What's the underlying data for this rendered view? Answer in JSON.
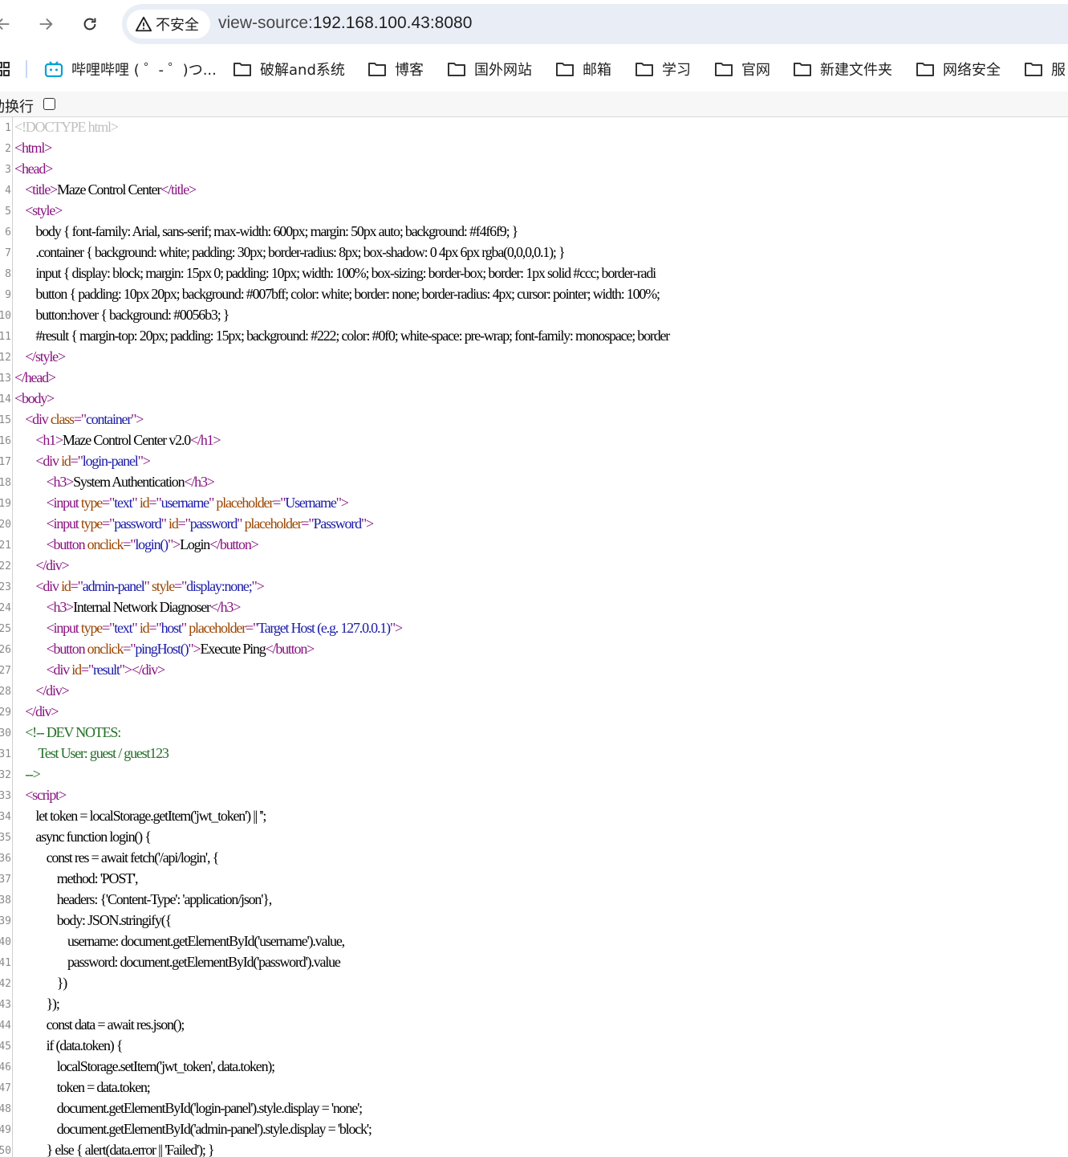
{
  "toolbar": {
    "security_label": "不安全",
    "url_scheme": "view-source:",
    "url_host": "192.168.100.43:8080"
  },
  "bookmarks": [
    {
      "label": "哔哩哔哩 ( ゜- ゜)つ...",
      "icon": "bilibili-icon"
    },
    {
      "label": "破解and系统",
      "icon": "folder-icon"
    },
    {
      "label": "博客",
      "icon": "folder-icon"
    },
    {
      "label": "国外网站",
      "icon": "folder-icon"
    },
    {
      "label": "邮箱",
      "icon": "folder-icon"
    },
    {
      "label": "学习",
      "icon": "folder-icon"
    },
    {
      "label": "官网",
      "icon": "folder-icon"
    },
    {
      "label": "新建文件夹",
      "icon": "folder-icon"
    },
    {
      "label": "网络安全",
      "icon": "folder-icon"
    },
    {
      "label": "服",
      "icon": "folder-icon"
    }
  ],
  "wrap_bar": {
    "label": "动换行",
    "checked": false
  },
  "colors": {
    "tag": "#881280",
    "attribute": "#994500",
    "value": "#1a1aa6",
    "comment": "#236e25",
    "doctype": "#c0c0c0"
  },
  "source_lines": [
    [
      [
        "dt",
        "<!DOCTYPE html>"
      ]
    ],
    [
      [
        "tag",
        "<html>"
      ]
    ],
    [
      [
        "tag",
        "<head>"
      ]
    ],
    [
      [
        "",
        "    "
      ],
      [
        "tag",
        "<title>"
      ],
      [
        "",
        "Maze Control Center"
      ],
      [
        "tag",
        "</title>"
      ]
    ],
    [
      [
        "",
        "    "
      ],
      [
        "tag",
        "<style>"
      ]
    ],
    [
      [
        "",
        "        body { font-family: Arial, sans-serif; max-width: 600px; margin: 50px auto; background: #f4f6f9; }"
      ]
    ],
    [
      [
        "",
        "        .container { background: white; padding: 30px; border-radius: 8px; box-shadow: 0 4px 6px rgba(0,0,0,0.1); }"
      ]
    ],
    [
      [
        "",
        "        input { display: block; margin: 15px 0; padding: 10px; width: 100%; box-sizing: border-box; border: 1px solid #ccc; border-radi"
      ]
    ],
    [
      [
        "",
        "        button { padding: 10px 20px; background: #007bff; color: white; border: none; border-radius: 4px; cursor: pointer; width: 100%;"
      ]
    ],
    [
      [
        "",
        "        button:hover { background: #0056b3; }"
      ]
    ],
    [
      [
        "",
        "        #result { margin-top: 20px; padding: 15px; background: #222; color: #0f0; white-space: pre-wrap; font-family: monospace; border"
      ]
    ],
    [
      [
        "",
        "    "
      ],
      [
        "tag",
        "</style>"
      ]
    ],
    [
      [
        "tag",
        "</head>"
      ]
    ],
    [
      [
        "tag",
        "<body>"
      ]
    ],
    [
      [
        "",
        "    "
      ],
      [
        "tag",
        "<div "
      ],
      [
        "attr",
        "class"
      ],
      [
        "tag",
        "=\""
      ],
      [
        "val",
        "container"
      ],
      [
        "tag",
        "\">"
      ]
    ],
    [
      [
        "",
        "        "
      ],
      [
        "tag",
        "<h1>"
      ],
      [
        "",
        "Maze Control Center v2.0"
      ],
      [
        "tag",
        "</h1>"
      ]
    ],
    [
      [
        "",
        "        "
      ],
      [
        "tag",
        "<div "
      ],
      [
        "attr",
        "id"
      ],
      [
        "tag",
        "=\""
      ],
      [
        "val",
        "login-panel"
      ],
      [
        "tag",
        "\">"
      ]
    ],
    [
      [
        "",
        "            "
      ],
      [
        "tag",
        "<h3>"
      ],
      [
        "",
        "System Authentication"
      ],
      [
        "tag",
        "</h3>"
      ]
    ],
    [
      [
        "",
        "            "
      ],
      [
        "tag",
        "<input "
      ],
      [
        "attr",
        "type"
      ],
      [
        "tag",
        "=\""
      ],
      [
        "val",
        "text"
      ],
      [
        "tag",
        "\" "
      ],
      [
        "attr",
        "id"
      ],
      [
        "tag",
        "=\""
      ],
      [
        "val",
        "username"
      ],
      [
        "tag",
        "\" "
      ],
      [
        "attr",
        "placeholder"
      ],
      [
        "tag",
        "=\""
      ],
      [
        "val",
        "Username"
      ],
      [
        "tag",
        "\">"
      ]
    ],
    [
      [
        "",
        "            "
      ],
      [
        "tag",
        "<input "
      ],
      [
        "attr",
        "type"
      ],
      [
        "tag",
        "=\""
      ],
      [
        "val",
        "password"
      ],
      [
        "tag",
        "\" "
      ],
      [
        "attr",
        "id"
      ],
      [
        "tag",
        "=\""
      ],
      [
        "val",
        "password"
      ],
      [
        "tag",
        "\" "
      ],
      [
        "attr",
        "placeholder"
      ],
      [
        "tag",
        "=\""
      ],
      [
        "val",
        "Password"
      ],
      [
        "tag",
        "\">"
      ]
    ],
    [
      [
        "",
        "            "
      ],
      [
        "tag",
        "<button "
      ],
      [
        "attr",
        "onclick"
      ],
      [
        "tag",
        "=\""
      ],
      [
        "val",
        "login()"
      ],
      [
        "tag",
        "\">"
      ],
      [
        "",
        "Login"
      ],
      [
        "tag",
        "</button>"
      ]
    ],
    [
      [
        "",
        "        "
      ],
      [
        "tag",
        "</div>"
      ]
    ],
    [
      [
        "",
        "        "
      ],
      [
        "tag",
        "<div "
      ],
      [
        "attr",
        "id"
      ],
      [
        "tag",
        "=\""
      ],
      [
        "val",
        "admin-panel"
      ],
      [
        "tag",
        "\" "
      ],
      [
        "attr",
        "style"
      ],
      [
        "tag",
        "=\""
      ],
      [
        "val",
        "display:none;"
      ],
      [
        "tag",
        "\">"
      ]
    ],
    [
      [
        "",
        "            "
      ],
      [
        "tag",
        "<h3>"
      ],
      [
        "",
        "Internal Network Diagnoser"
      ],
      [
        "tag",
        "</h3>"
      ]
    ],
    [
      [
        "",
        "            "
      ],
      [
        "tag",
        "<input "
      ],
      [
        "attr",
        "type"
      ],
      [
        "tag",
        "=\""
      ],
      [
        "val",
        "text"
      ],
      [
        "tag",
        "\" "
      ],
      [
        "attr",
        "id"
      ],
      [
        "tag",
        "=\""
      ],
      [
        "val",
        "host"
      ],
      [
        "tag",
        "\" "
      ],
      [
        "attr",
        "placeholder"
      ],
      [
        "tag",
        "=\""
      ],
      [
        "val",
        "Target Host (e.g. 127.0.0.1)"
      ],
      [
        "tag",
        "\">"
      ]
    ],
    [
      [
        "",
        "            "
      ],
      [
        "tag",
        "<button "
      ],
      [
        "attr",
        "onclick"
      ],
      [
        "tag",
        "=\""
      ],
      [
        "val",
        "pingHost()"
      ],
      [
        "tag",
        "\">"
      ],
      [
        "",
        "Execute Ping"
      ],
      [
        "tag",
        "</button>"
      ]
    ],
    [
      [
        "",
        "            "
      ],
      [
        "tag",
        "<div "
      ],
      [
        "attr",
        "id"
      ],
      [
        "tag",
        "=\""
      ],
      [
        "val",
        "result"
      ],
      [
        "tag",
        "\"></div>"
      ]
    ],
    [
      [
        "",
        "        "
      ],
      [
        "tag",
        "</div>"
      ]
    ],
    [
      [
        "",
        "    "
      ],
      [
        "tag",
        "</div>"
      ]
    ],
    [
      [
        "",
        "    "
      ],
      [
        "cmt",
        "<!-- DEV NOTES:"
      ]
    ],
    [
      [
        "cmt",
        "         Test User: guest / guest123"
      ]
    ],
    [
      [
        "",
        "    "
      ],
      [
        "cmt",
        "-->"
      ]
    ],
    [
      [
        "",
        "    "
      ],
      [
        "tag",
        "<script>"
      ]
    ],
    [
      [
        "",
        "        let token = localStorage.getItem('jwt_token') || '';"
      ]
    ],
    [
      [
        "",
        "        async function login() {"
      ]
    ],
    [
      [
        "",
        "            const res = await fetch('/api/login', {"
      ]
    ],
    [
      [
        "",
        "                method: 'POST',"
      ]
    ],
    [
      [
        "",
        "                headers: {'Content-Type': 'application/json'},"
      ]
    ],
    [
      [
        "",
        "                body: JSON.stringify({"
      ]
    ],
    [
      [
        "",
        "                    username: document.getElementById('username').value,"
      ]
    ],
    [
      [
        "",
        "                    password: document.getElementById('password').value"
      ]
    ],
    [
      [
        "",
        "                })"
      ]
    ],
    [
      [
        "",
        "            });"
      ]
    ],
    [
      [
        "",
        "            const data = await res.json();"
      ]
    ],
    [
      [
        "",
        "            if (data.token) {"
      ]
    ],
    [
      [
        "",
        "                localStorage.setItem('jwt_token', data.token);"
      ]
    ],
    [
      [
        "",
        "                token = data.token;"
      ]
    ],
    [
      [
        "",
        "                document.getElementById('login-panel').style.display = 'none';"
      ]
    ],
    [
      [
        "",
        "                document.getElementById('admin-panel').style.display = 'block';"
      ]
    ],
    [
      [
        "",
        "            } else { alert(data.error || 'Failed'); }"
      ]
    ]
  ]
}
